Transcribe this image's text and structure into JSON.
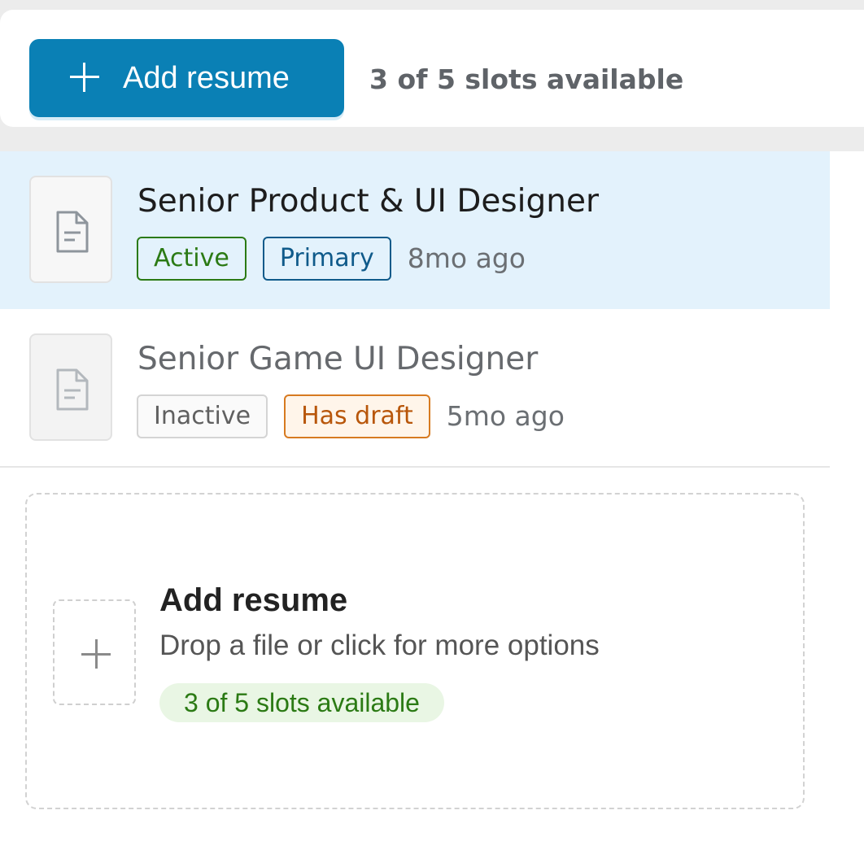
{
  "toolbar": {
    "add_button_label": "Add resume",
    "slots_text": "3 of 5 slots available"
  },
  "resumes": [
    {
      "title": "Senior Product & UI Designer",
      "tags": [
        "Active",
        "Primary"
      ],
      "time": "8mo ago",
      "selected": true
    },
    {
      "title": "Senior Game UI Designer",
      "tags": [
        "Inactive",
        "Has draft"
      ],
      "time": "5mo ago",
      "selected": false
    }
  ],
  "dropzone": {
    "title": "Add resume",
    "subtitle": "Drop a file or click for more options",
    "slots_pill": "3 of 5 slots available"
  },
  "colors": {
    "primary_button": "#0a80b5",
    "selected_row": "#e3f2fc",
    "active_tag": "#2b7a14",
    "primary_tag": "#0f5a8a",
    "draft_tag": "#d77a20"
  }
}
